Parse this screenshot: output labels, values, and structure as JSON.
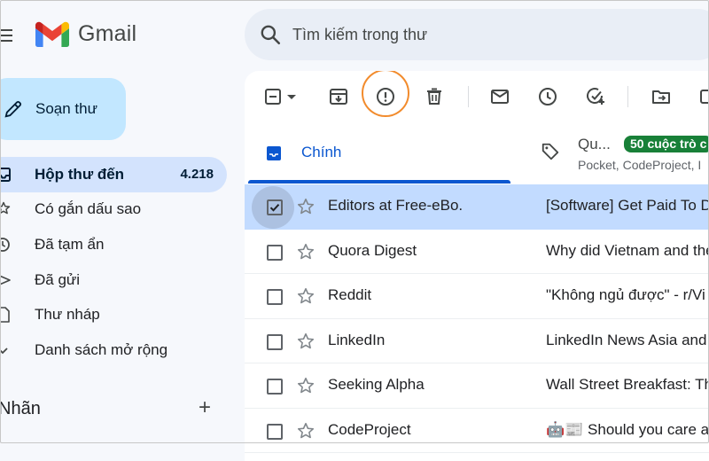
{
  "app": {
    "name": "Gmail",
    "brand_colors": {
      "red": "#ea4335",
      "blue": "#4285f4",
      "green": "#34a853",
      "yellow": "#fbbc04",
      "darkred": "#c5221f"
    }
  },
  "search": {
    "placeholder": "Tìm kiếm trong thư",
    "value": ""
  },
  "sidebar": {
    "compose_label": "Soạn thư",
    "items": [
      {
        "label": "Hộp thư đến",
        "count": "4.218",
        "icon": "inbox-icon",
        "active": true
      },
      {
        "label": "Có gắn dấu sao",
        "count": "",
        "icon": "star-icon"
      },
      {
        "label": "Đã tạm ẩn",
        "count": "",
        "icon": "clock-icon"
      },
      {
        "label": "Đã gửi",
        "count": "",
        "icon": "send-icon"
      },
      {
        "label": "Thư nháp",
        "count": "",
        "icon": "draft-icon"
      },
      {
        "label": "Danh sách mở rộng",
        "count": "",
        "icon": "chevron-down-icon"
      }
    ],
    "labels_title": "Nhãn",
    "labels_add": "+"
  },
  "toolbar": {
    "icons": [
      "select-checkbox-icon",
      "dropdown-arrow-icon",
      "archive-icon",
      "report-spam-icon",
      "delete-icon",
      "mark-unread-icon",
      "snooze-icon",
      "add-task-icon",
      "move-to-icon"
    ],
    "highlighted": "report-spam-icon",
    "highlight_color": "#f28b2c"
  },
  "tabs": {
    "primary": {
      "label": "Chính",
      "icon": "inbox-tab-icon"
    },
    "promotions": {
      "title": "Qu...",
      "badge": "50 cuộc trò c",
      "senders": "Pocket, CodeProject, I",
      "badge_color": "#188038"
    }
  },
  "emails": [
    {
      "sender": "Editors at Free-eBo.",
      "subject": "[Software] Get Paid To Do",
      "selected": true
    },
    {
      "sender": "Quora Digest",
      "subject": "Why did Vietnam and the",
      "selected": false
    },
    {
      "sender": "Reddit",
      "subject": "\"Không ngủ được\" - r/Vi",
      "selected": false
    },
    {
      "sender": "LinkedIn",
      "subject": "LinkedIn News Asia and",
      "selected": false
    },
    {
      "sender": "Seeking Alpha",
      "subject": "Wall Street Breakfast: Th",
      "selected": false
    },
    {
      "sender": "CodeProject",
      "subject": "🤖📰 Should you care a",
      "selected": false
    }
  ]
}
